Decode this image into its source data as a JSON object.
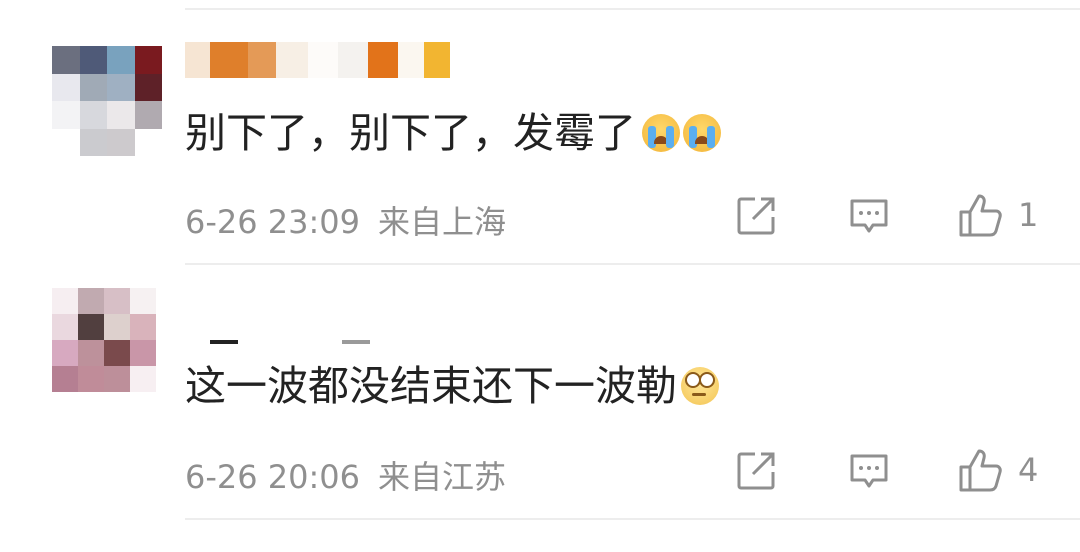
{
  "comments": [
    {
      "text": "别下了，别下了，发霉了",
      "emojis": [
        "cry-emoji",
        "cry-emoji"
      ],
      "time": "6-26 23:09",
      "location": "来自上海",
      "likes": "1"
    },
    {
      "text": "这一波都没结束还下一波勒",
      "emojis": [
        "eye-roll-emoji"
      ],
      "time": "6-26 20:06",
      "location": "来自江苏",
      "likes": "4"
    }
  ],
  "colors": {
    "text": "#222222",
    "meta": "#8f8f8f",
    "divider": "#ededed"
  }
}
